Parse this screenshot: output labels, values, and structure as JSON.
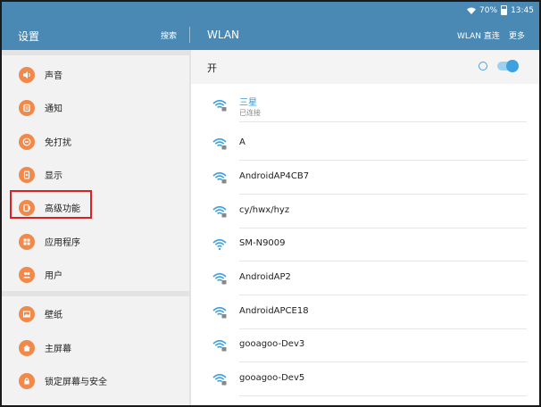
{
  "status_bar": {
    "battery": "70%",
    "time": "13:45"
  },
  "app_bar": {
    "left_title": "设置",
    "search_label": "搜索",
    "right_title": "WLAN",
    "wlan_direct_label": "WLAN 直连",
    "more_label": "更多"
  },
  "sidebar": {
    "items": [
      {
        "label": "声音",
        "icon": "speaker-icon"
      },
      {
        "label": "通知",
        "icon": "notification-icon"
      },
      {
        "label": "免打扰",
        "icon": "do-not-disturb-icon"
      },
      {
        "label": "显示",
        "icon": "display-icon"
      },
      {
        "label": "高级功能",
        "icon": "advanced-features-icon"
      },
      {
        "label": "应用程序",
        "icon": "apps-grid-icon"
      },
      {
        "label": "用户",
        "icon": "users-icon"
      },
      {
        "label": "壁纸",
        "icon": "wallpaper-icon"
      },
      {
        "label": "主屏幕",
        "icon": "home-icon"
      },
      {
        "label": "锁定屏幕与安全",
        "icon": "lock-icon"
      }
    ]
  },
  "wlan": {
    "toggle_label": "开",
    "toggle_on": true,
    "networks": [
      {
        "name": "三星",
        "status": "已连接"
      },
      {
        "name": "A"
      },
      {
        "name": "AndroidAP4CB7"
      },
      {
        "name": "cy/hwx/hyz"
      },
      {
        "name": "SM-N9009"
      },
      {
        "name": "AndroidAP2"
      },
      {
        "name": "AndroidAPCE18"
      },
      {
        "name": "gooagoo-Dev3"
      },
      {
        "name": "gooagoo-Dev5"
      }
    ]
  },
  "colors": {
    "app_bar": "#4a89b4",
    "menu_icon": "#f0894a",
    "accent": "#3ea1df",
    "highlight": "#e02020"
  }
}
